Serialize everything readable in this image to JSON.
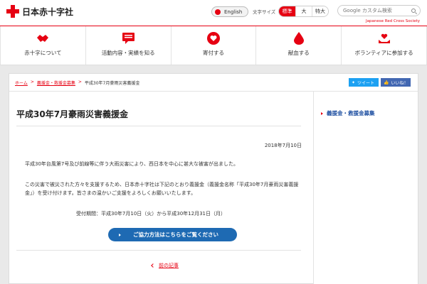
{
  "header": {
    "logo_text": "日本赤十字社",
    "lang_label": "English",
    "font_size_label": "文字サイズ",
    "font_sizes": [
      "標準",
      "大",
      "特大"
    ],
    "search_placeholder": "Google カスタム検索",
    "org_en": "Japanese Red Cross Society"
  },
  "nav": [
    {
      "label": "赤十字について",
      "icon": "handshake-icon"
    },
    {
      "label": "活動内容・実績を知る",
      "icon": "speech-bubble-icon"
    },
    {
      "label": "寄付する",
      "icon": "heart-icon"
    },
    {
      "label": "献血する",
      "icon": "blood-drop-icon"
    },
    {
      "label": "ボランティアに参加する",
      "icon": "heart-hands-icon"
    }
  ],
  "breadcrumb": [
    "ホーム",
    "義援金・救援金募集",
    "平成30年7月豪雨災害義援金"
  ],
  "share": {
    "tweet": "ツイート",
    "like": "いいね！"
  },
  "main": {
    "title": "平成30年7月豪雨災害義援金",
    "date": "2018年7月10日",
    "para1": "平成30年台風第7号及び前線等に伴う大雨災害により、西日本を中心に甚大な被害が出ました。",
    "para2": "この災害で被災された方々を支援するため、日本赤十字社は下記のとおり義援金（義援金名称「平成30年7月豪雨災害義援金」）を受け付けます。皆さまの温かいご支援をよろしくお願いいたします。",
    "reception": "受付期間：平成30年7月10日（火）から平成30年12月31日（月）",
    "cta": "ご協力方法はこちらをご覧ください",
    "prev": "前の記事"
  },
  "sidebar": {
    "item": "義援金・救援金募集"
  },
  "colors": {
    "brand_red": "#e60012",
    "cta_blue": "#1e6ab3",
    "link_blue": "#1e4fa1"
  }
}
